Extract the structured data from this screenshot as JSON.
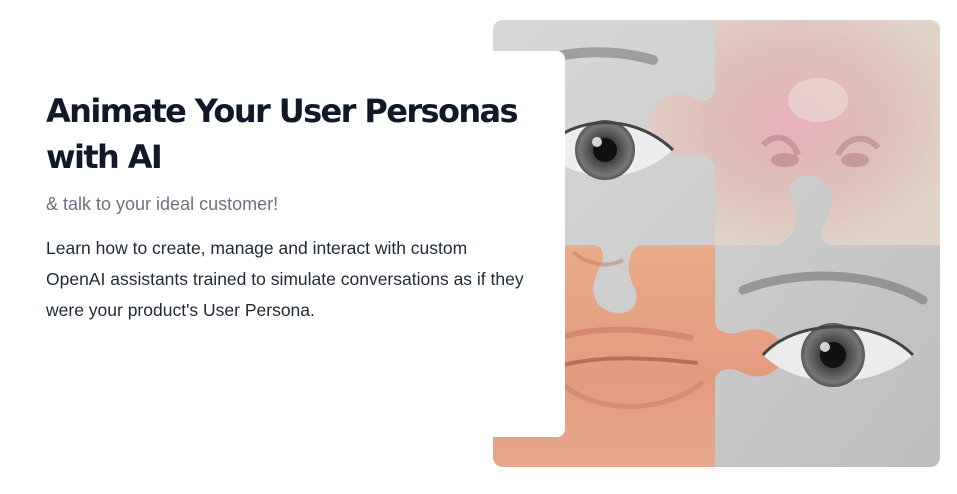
{
  "hero": {
    "title": "Animate Your User Personas with AI",
    "subtitle": "& talk to your ideal customer!",
    "description": "Learn how to create, manage and interact with custom OpenAI assistants trained to simulate conversations as if they were your product's User Persona."
  },
  "image": {
    "subject": "puzzle-collage-face",
    "colors": {
      "grayscale": "#cccccc",
      "skin": "#e6a585",
      "pink": "#e8c9c4",
      "puzzle_beige": "#d9cfc3"
    }
  }
}
